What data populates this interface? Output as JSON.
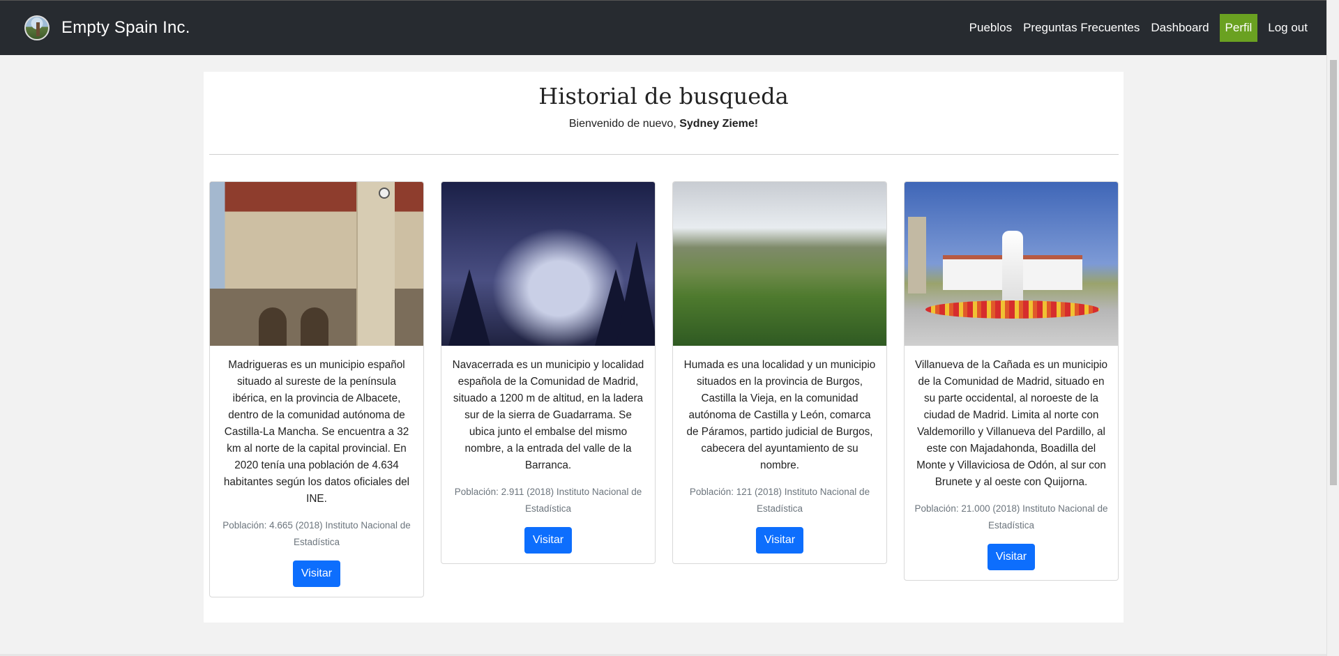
{
  "navbar": {
    "brand": "Empty Spain Inc.",
    "links": [
      {
        "label": "Pueblos"
      },
      {
        "label": "Preguntas Frecuentes"
      },
      {
        "label": "Dashboard"
      },
      {
        "label": "Perfil",
        "active": true
      },
      {
        "label": "Log out"
      }
    ],
    "active_color": "#6aa121",
    "background": "#272b30"
  },
  "main": {
    "title": "Historial de busqueda",
    "welcome_prefix": "Bienvenido de nuevo, ",
    "user_name": "Sydney Zieme!"
  },
  "cards": [
    {
      "image_icon": "town-hall-clock-tower-photo",
      "description": "Madrigueras es un municipio español situado al sureste de la península ibérica, en la provincia de Albacete, dentro de la comunidad autónoma de Castilla-La Mancha. Se encuentra a 32 km al norte de la capital provincial. En 2020 tenía una población de 4.634 habitantes según los datos oficiales del INE.",
      "population": "Población: 4.665 (2018) Instituto Nacional de Estadística",
      "button": "Visitar"
    },
    {
      "image_icon": "snowy-village-night-photo",
      "description": "Navacerrada es un municipio y localidad española de la Comunidad de Madrid, situado a 1200 m de altitud, en la ladera sur de la sierra de Guadarrama. Se ubica junto el embalse del mismo nombre, a la entrada del valle de la Barranca.",
      "population": "Población: 2.911 (2018) Instituto Nacional de Estadística",
      "button": "Visitar"
    },
    {
      "image_icon": "green-valley-landscape-photo",
      "description": "Humada es una localidad y un municipio situados en la provincia de Burgos, Castilla la Vieja, en la comunidad autónoma de Castilla y León, comarca de Páramos, partido judicial de Burgos, cabecera del ayuntamiento de su nombre.",
      "population": "Población: 121 (2018) Instituto Nacional de Estadística",
      "button": "Visitar"
    },
    {
      "image_icon": "town-square-fountain-photo",
      "description": "Villanueva de la Cañada es un municipio de la Comunidad de Madrid, situado en su parte occidental, al noroeste de la ciudad de Madrid. Limita al norte con Valdemorillo y Villanueva del Pardillo, al este con Majadahonda, Boadilla del Monte y Villaviciosa de Odón, al sur con Brunete y al oeste con Quijorna.",
      "population": "Población: 21.000 (2018) Instituto Nacional de Estadística",
      "button": "Visitar"
    }
  ],
  "button_color": "#0d6efd"
}
